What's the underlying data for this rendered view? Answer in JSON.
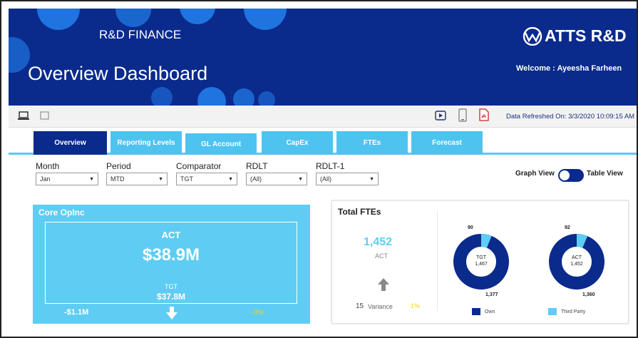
{
  "banner": {
    "department": "R&D FINANCE",
    "title": "Overview Dashboard",
    "logo_text": "ATTS R&D",
    "welcome": "Welcome : Ayeesha Farheen"
  },
  "toolbar": {
    "refreshed": "Data Refreshed On: 3/3/2020 10:09:15 AM"
  },
  "tabs": [
    {
      "label": "Overview"
    },
    {
      "label": "Reporting Levels"
    },
    {
      "label": "GL Account"
    },
    {
      "label": "CapEx"
    },
    {
      "label": "FTEs"
    },
    {
      "label": "Forecast"
    }
  ],
  "filters": [
    {
      "label": "Month",
      "value": "Jan"
    },
    {
      "label": "Period",
      "value": "MTD"
    },
    {
      "label": "Comparator",
      "value": "TGT"
    },
    {
      "label": "RDLT",
      "value": "(All)"
    },
    {
      "label": "RDLT-1",
      "value": "(All)"
    }
  ],
  "view_toggle": {
    "left": "Graph View",
    "right": "Table View"
  },
  "core": {
    "title": "Core OpInc",
    "act_label": "ACT",
    "act_value": "$38.9M",
    "tgt_label": "TGT",
    "tgt_value": "$37.8M",
    "variance_amount": "-$1.1M",
    "variance_pct": "-3%"
  },
  "fte": {
    "title": "Total FTEs",
    "act_value": "1,452",
    "act_label": "ACT",
    "variance_num": "15",
    "variance_label": "Variance",
    "variance_pct": "1%",
    "donuts": [
      {
        "center_label": "TGT",
        "center_value": "1,467",
        "third_party": "90",
        "own": "1,377"
      },
      {
        "center_label": "ACT",
        "center_value": "1,452",
        "third_party": "92",
        "own": "1,360"
      }
    ],
    "legend": {
      "own": "Own",
      "third_party": "Third Party"
    }
  },
  "colors": {
    "navy": "#0a2a8c",
    "light_blue": "#5fcdf3",
    "yellow": "#f2d21b"
  }
}
